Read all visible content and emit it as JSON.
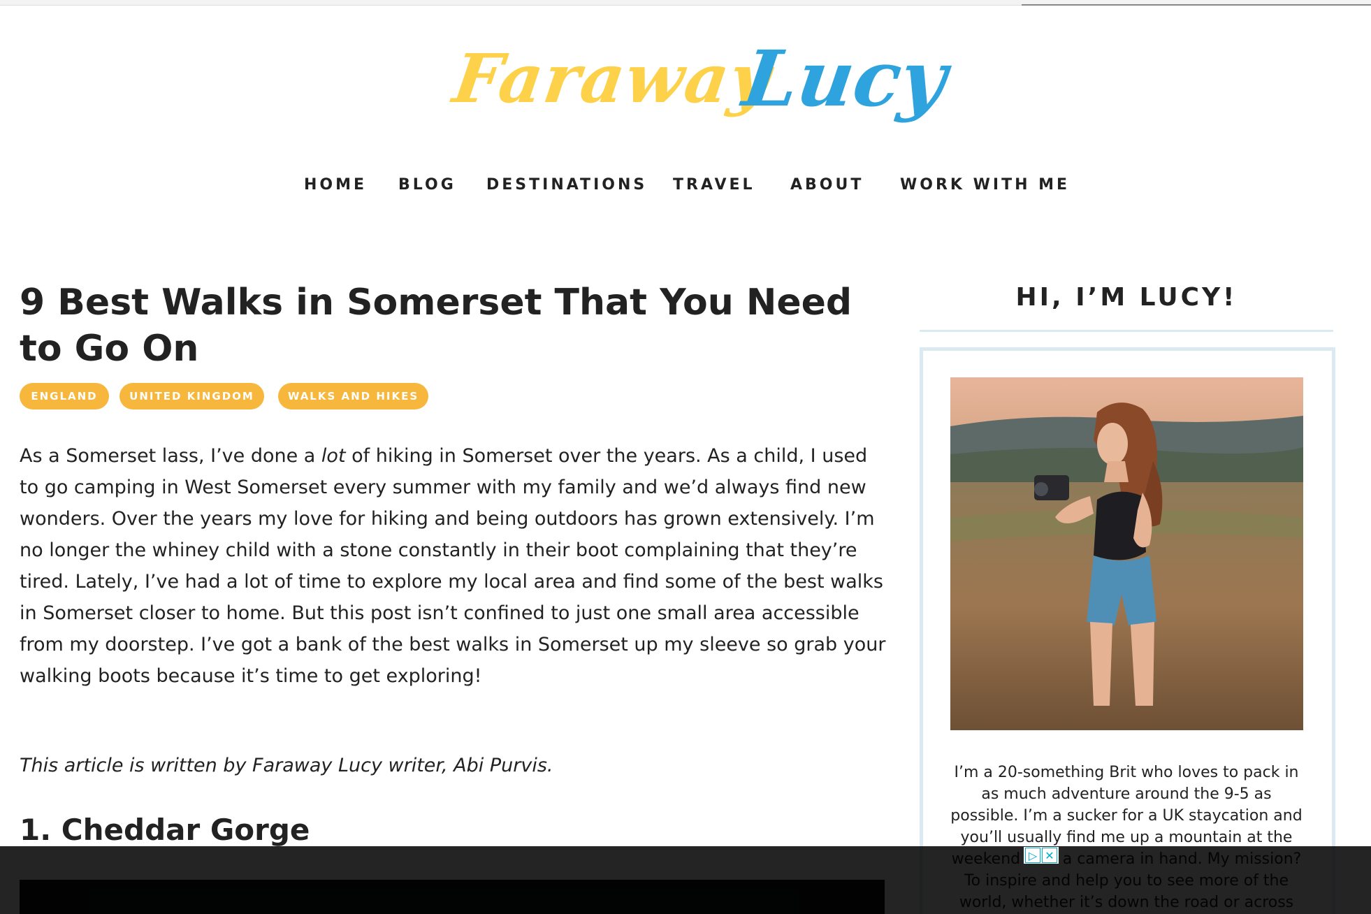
{
  "site": {
    "logo_part1": "Faraway",
    "logo_part2": "Lucy",
    "colors": {
      "logo_yellow": "#fdd24a",
      "logo_blue": "#2ea3dd",
      "tag_bg": "#f6b73c",
      "sidebar_border": "#dbe9f3"
    }
  },
  "nav": {
    "items": [
      "HOME",
      "BLOG",
      "DESTINATIONS",
      "TRAVEL",
      "ABOUT",
      "WORK WITH ME"
    ]
  },
  "post": {
    "title": "9 Best Walks in Somerset That You Need to Go On",
    "tags": [
      "ENGLAND",
      "UNITED KINGDOM",
      "WALKS AND HIKES"
    ],
    "intro_before_em": "As a Somerset lass, I’ve done a ",
    "intro_em": "lot",
    "intro_after_em": " of hiking in Somerset over the years. As a child, I used to go camping in West Somerset every summer with my family and we’d always find new wonders. Over the years my love for hiking and being outdoors has grown extensively. I’m no longer the whiney child with a stone constantly in their boot complaining that they’re tired. Lately, I’ve had a lot of time to explore my local area and find some of the best walks in Somerset closer to home. But this post isn’t confined to just one small area accessible from my doorstep. I’ve got a bank of the best walks in Somerset up my sleeve so grab your walking boots because it’s time to get exploring!",
    "credit": "This article is written by Faraway Lucy writer, Abi Purvis.",
    "section_1_heading": "1. Cheddar Gorge"
  },
  "sidebar": {
    "title": "HI, I’M LUCY!",
    "bio": "I’m a 20-something Brit who loves to pack in as much adventure around the 9-5 as possible. I’m a sucker for a UK staycation and you’ll usually find me up a mountain at the weekend with a camera in hand. My mission? To inspire and help you to see more of the world, whether it’s down the road or across"
  },
  "ad": {
    "icons": [
      "adchoices-icon",
      "close-icon"
    ]
  }
}
